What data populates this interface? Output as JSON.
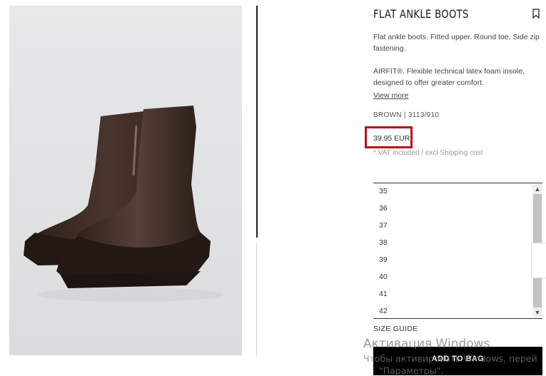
{
  "product": {
    "title": "FLAT ANKLE BOOTS",
    "description": "Flat ankle boots. Fitted upper. Round toe. Side zip fastening.",
    "airfit": "AIRFIT®. Flexible technical latex foam insole, designed to offer greater comfort.",
    "view_more": "View more",
    "color_ref": "BROWN | 3113/910",
    "price": "39.95 EUR",
    "vat_note": "* VAT included / excl Shipping cost"
  },
  "sizes": [
    "35",
    "36",
    "37",
    "38",
    "39",
    "40",
    "41",
    "42"
  ],
  "size_guide": "SIZE GUIDE",
  "add_to_bag": "ADD TO BAG",
  "icons": {
    "bookmark": "bookmark-icon",
    "scroll_up": "chevron-up-icon",
    "scroll_down": "chevron-down-icon"
  },
  "colors": {
    "highlight": "#b7121a",
    "button": "#000000",
    "boot": "#3b2a24"
  },
  "watermark": {
    "line1": "Активация Windows",
    "line2": "Чтобы активировать Windows, перей",
    "line3": "\"Параметры\"."
  }
}
